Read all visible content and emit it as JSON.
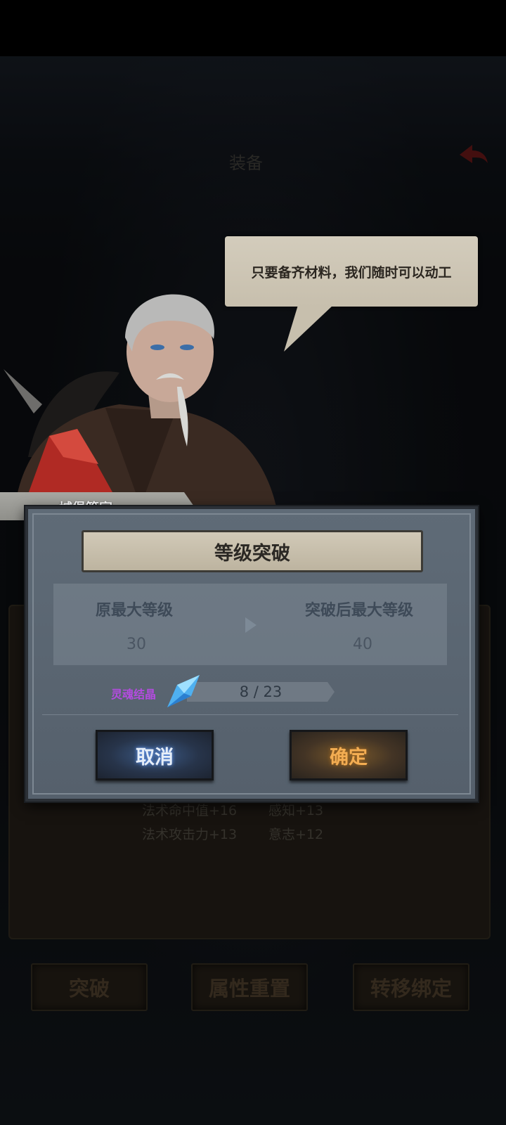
{
  "background": {
    "title": "装备",
    "stats": [
      "法术命中值+16",
      "感知+13",
      "法术攻击力+13",
      "意志+12"
    ],
    "tabs": [
      "突破",
      "属性重置",
      "转移绑定"
    ]
  },
  "npc": {
    "name": "城堡管家",
    "speech": "只要备齐材料，我们随时可以动工"
  },
  "dialog": {
    "title": "等级突破",
    "original_label": "原最大等级",
    "original_value": "30",
    "after_label": "突破后最大等级",
    "after_value": "40",
    "material_name": "灵魂结晶",
    "material_count": "8 / 23",
    "cancel_label": "取消",
    "confirm_label": "确定"
  },
  "colors": {
    "material": "#b44be0",
    "confirm_text": "#f3ad52",
    "cancel_glow": "#6aa0ff"
  }
}
